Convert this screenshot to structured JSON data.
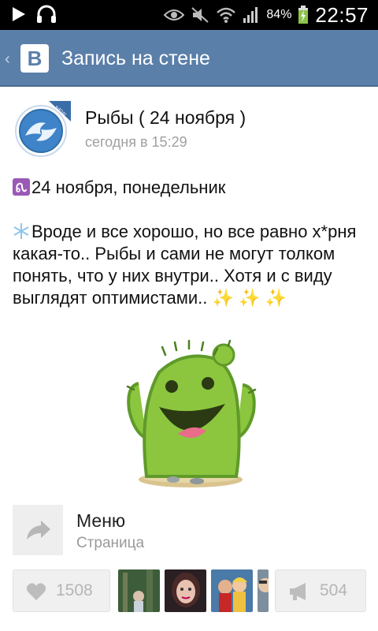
{
  "status_bar": {
    "battery": "84%",
    "time": "22:57"
  },
  "action_bar": {
    "title": "Запись на стене",
    "logo_letter": "B"
  },
  "post": {
    "author": "Рыбы ( 24 ноября )",
    "time": "сегодня в 15:29",
    "avatar_badge": "NEW",
    "date_line": "24 ноября, понедельник",
    "body_text": "Вроде и все хорошо, но все равно х*рня какая-то.. Рыбы и сами не могут толком понять, что у них внутри.. Хотя и с виду выглядят оптимистами.."
  },
  "attachment": {
    "title": "Меню",
    "subtitle": "Страница"
  },
  "actions": {
    "like_count": "1508",
    "share_count": "504"
  },
  "colors": {
    "action_bar": "#5a7fa9",
    "cactus_green": "#8cc63f"
  }
}
